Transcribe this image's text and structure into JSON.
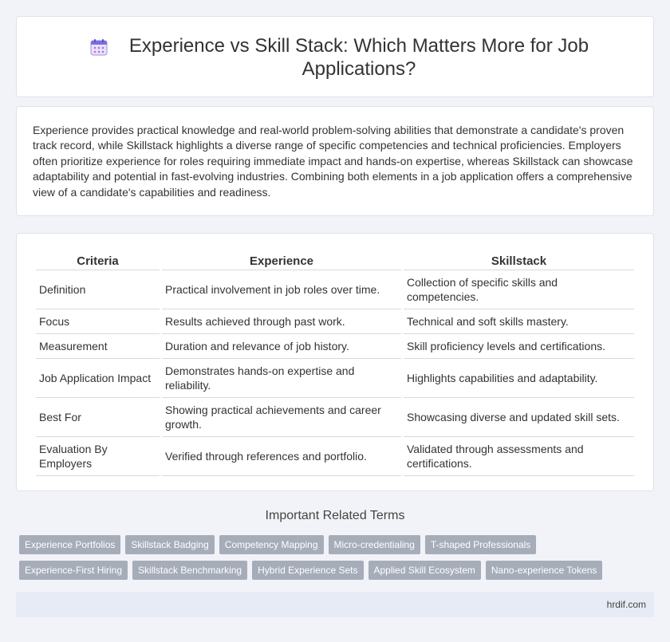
{
  "header": {
    "title": "Experience vs Skill Stack: Which Matters More for Job Applications?",
    "icon": "calendar-icon"
  },
  "intro": "Experience provides practical knowledge and real-world problem-solving abilities that demonstrate a candidate's proven track record, while Skillstack highlights a diverse range of specific competencies and technical proficiencies. Employers often prioritize experience for roles requiring immediate impact and hands-on expertise, whereas Skillstack can showcase adaptability and potential in fast-evolving industries. Combining both elements in a job application offers a comprehensive view of a candidate's capabilities and readiness.",
  "table": {
    "headers": [
      "Criteria",
      "Experience",
      "Skillstack"
    ],
    "rows": [
      [
        "Definition",
        "Practical involvement in job roles over time.",
        "Collection of specific skills and competencies."
      ],
      [
        "Focus",
        "Results achieved through past work.",
        "Technical and soft skills mastery."
      ],
      [
        "Measurement",
        "Duration and relevance of job history.",
        "Skill proficiency levels and certifications."
      ],
      [
        "Job Application Impact",
        "Demonstrates hands-on expertise and reliability.",
        "Highlights capabilities and adaptability."
      ],
      [
        "Best For",
        "Showing practical achievements and career growth.",
        "Showcasing diverse and updated skill sets."
      ],
      [
        "Evaluation By Employers",
        "Verified through references and portfolio.",
        "Validated through assessments and certifications."
      ]
    ]
  },
  "related": {
    "title": "Important Related Terms",
    "row1": [
      "Experience Portfolios",
      "Skillstack Badging",
      "Competency Mapping",
      "Micro-credentialing",
      "T-shaped Professionals"
    ],
    "row2": [
      "Experience-First Hiring",
      "Skillstack Benchmarking",
      "Hybrid Experience Sets",
      "Applied Skill Ecosystem",
      "Nano-experience Tokens"
    ]
  },
  "footer": {
    "site": "hrdif.com"
  },
  "colors": {
    "tag_bg": "#a6adb8",
    "page_bg": "#f1f3f8",
    "footer_bg": "#e6ebf5",
    "icon_accent": "#7b6ee0"
  }
}
